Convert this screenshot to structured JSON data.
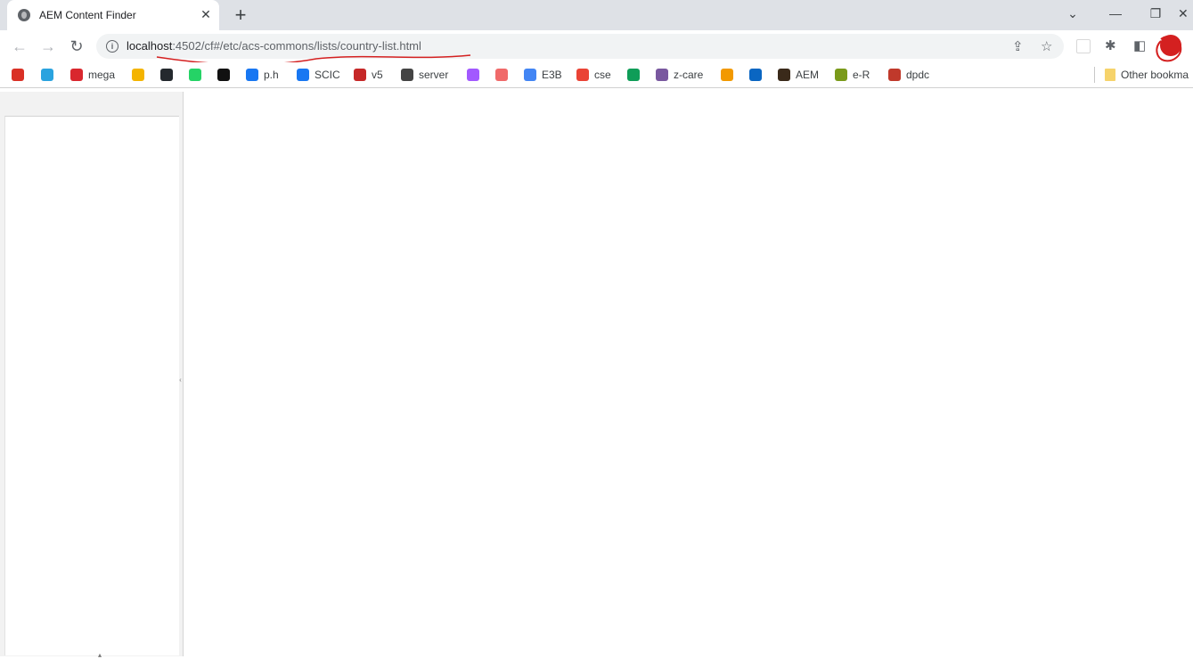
{
  "browser": {
    "tab": {
      "title": "AEM Content Finder",
      "close_glyph": "✕",
      "favicon": "globe-icon"
    },
    "new_tab_glyph": "+",
    "window_controls": {
      "tab_search": "⌄",
      "minimize": "—",
      "restore": "❐",
      "close": "✕"
    },
    "nav": {
      "back": "←",
      "forward": "→",
      "reload": "↻"
    },
    "address": {
      "host": "localhost",
      "rest": ":4502/cf#/etc/acs-commons/lists/country-list.html",
      "info_glyph": "i",
      "annotation_color": "#d42020"
    },
    "toolbar_icons": {
      "share": "⇪",
      "bookmark_star": "☆",
      "extensions": "✱",
      "side_panel": "◧"
    },
    "bookmarks": [
      {
        "label": "",
        "icon": "speedometer-icon",
        "color": "#d93025"
      },
      {
        "label": "",
        "icon": "telegram-icon",
        "color": "#2aa3df"
      },
      {
        "label": "mega",
        "icon": "mega-icon",
        "color": "#d9272e"
      },
      {
        "label": "",
        "icon": "hand-icon",
        "color": "#f4b400"
      },
      {
        "label": "",
        "icon": "github-icon",
        "color": "#24292e"
      },
      {
        "label": "",
        "icon": "whatsapp-icon",
        "color": "#25d366"
      },
      {
        "label": "",
        "icon": "notes-icon",
        "color": "#111111"
      },
      {
        "label": "p.h",
        "icon": "facebook-icon",
        "color": "#1877f2"
      },
      {
        "label": "SCIC",
        "icon": "facebook-icon",
        "color": "#1877f2"
      },
      {
        "label": "v5",
        "icon": "dots-icon",
        "color": "#c62828"
      },
      {
        "label": "server",
        "icon": "server-icon",
        "color": "#444444"
      },
      {
        "label": "",
        "icon": "figma-icon",
        "color": "#a259ff"
      },
      {
        "label": "",
        "icon": "asana-icon",
        "color": "#f06a6a"
      },
      {
        "label": "E3B",
        "icon": "google-icon",
        "color": "#4285f4"
      },
      {
        "label": "cse",
        "icon": "gmail-icon",
        "color": "#ea4335"
      },
      {
        "label": "",
        "icon": "chat-icon",
        "color": "#0f9d58"
      },
      {
        "label": "z-care",
        "icon": "heroku-icon",
        "color": "#79589f"
      },
      {
        "label": "",
        "icon": "ring-icon",
        "color": "#f29900"
      },
      {
        "label": "",
        "icon": "linkedin-icon",
        "color": "#0a66c2"
      },
      {
        "label": "AEM",
        "icon": "aem-icon",
        "color": "#3a2a1a"
      },
      {
        "label": "e-R",
        "icon": "er-icon",
        "color": "#7a9a1a"
      },
      {
        "label": "dpdc",
        "icon": "dpdc-icon",
        "color": "#c0392b"
      }
    ],
    "other_bookmarks": "Other bookma"
  },
  "content_finder": {
    "split_handle_glyph": "‹",
    "bottom_handle_glyph": "▴"
  }
}
